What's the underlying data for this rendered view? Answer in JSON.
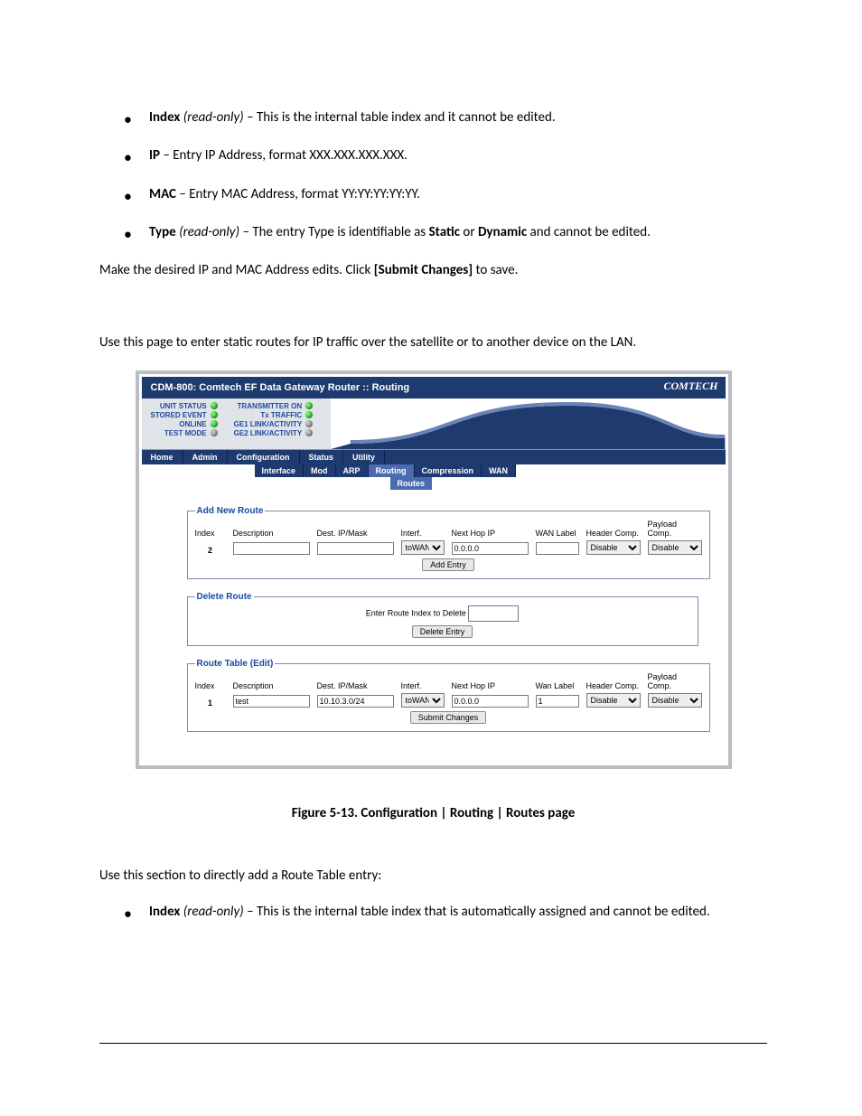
{
  "bullets_top": [
    {
      "term": "Index",
      "qual": "(read-only)",
      "rest": " – This is the internal table index and it cannot be edited."
    },
    {
      "term": "IP",
      "qual": "",
      "rest": " – Entry IP Address, format XXX.XXX.XXX.XXX."
    },
    {
      "term": "MAC",
      "qual": "",
      "rest": " – Entry MAC Address, format YY:YY:YY:YY:YY."
    },
    {
      "term": "Type",
      "qual": "(read-only)",
      "rest_pre": " – The entry Type is identifiable as ",
      "b1": "Static",
      "mid": " or ",
      "b2": "Dynamic",
      "rest_post": " and cannot be edited."
    }
  ],
  "para1_pre": "Make the desired IP and MAC Address edits. Click ",
  "para1_b": "[Submit Changes]",
  "para1_post": " to save.",
  "para2": "Use this page to enter static routes for IP traffic over the satellite or to another device on the LAN.",
  "router": {
    "title": "CDM-800: Comtech EF Data Gateway Router :: Routing",
    "logo": "COMTECH",
    "leds_left": [
      "UNIT STATUS",
      "STORED EVENT",
      "ONLINE",
      "TEST MODE"
    ],
    "leds_right": [
      "TRANSMITTER ON",
      "Tx TRAFFIC",
      "GE1 LINK/ACTIVITY",
      "GE2 LINK/ACTIVITY"
    ],
    "nav1": [
      "Home",
      "Admin",
      "Configuration",
      "Status",
      "Utility"
    ],
    "nav2": [
      "Interface",
      "Mod",
      "ARP",
      "Routing",
      "Compression",
      "WAN"
    ],
    "nav3": [
      "Routes"
    ],
    "add": {
      "legend": "Add New Route",
      "headers": [
        "Index",
        "Description",
        "Dest. IP/Mask",
        "Interf.",
        "Next Hop IP",
        "WAN Label",
        "Header Comp.",
        "Payload Comp."
      ],
      "index": "2",
      "interf": "toWAN",
      "nexthop": "0.0.0.0",
      "hc": "Disable",
      "pc": "Disable",
      "btn": "Add Entry"
    },
    "del": {
      "legend": "Delete Route",
      "label": "Enter Route Index to Delete",
      "btn": "Delete Entry"
    },
    "edit": {
      "legend": "Route Table (Edit)",
      "headers": [
        "Index",
        "Description",
        "Dest. IP/Mask",
        "Interf.",
        "Next Hop IP",
        "Wan Label",
        "Header Comp.",
        "Payload Comp."
      ],
      "index": "1",
      "desc": "test",
      "ipmask": "10.10.3.0/24",
      "interf": "toWAN",
      "nexthop": "0.0.0.0",
      "wanlabel": "1",
      "hc": "Disable",
      "pc": "Disable",
      "btn": "Submit Changes"
    }
  },
  "figcap": "Figure 5-13. Configuration | Routing | Routes page",
  "para3": "Use this section to directly add a Route Table entry:",
  "bullets_bot": [
    {
      "term": "Index",
      "qual": "(read-only)",
      "rest": " – This is the internal table index that is automatically assigned and cannot be edited."
    }
  ]
}
